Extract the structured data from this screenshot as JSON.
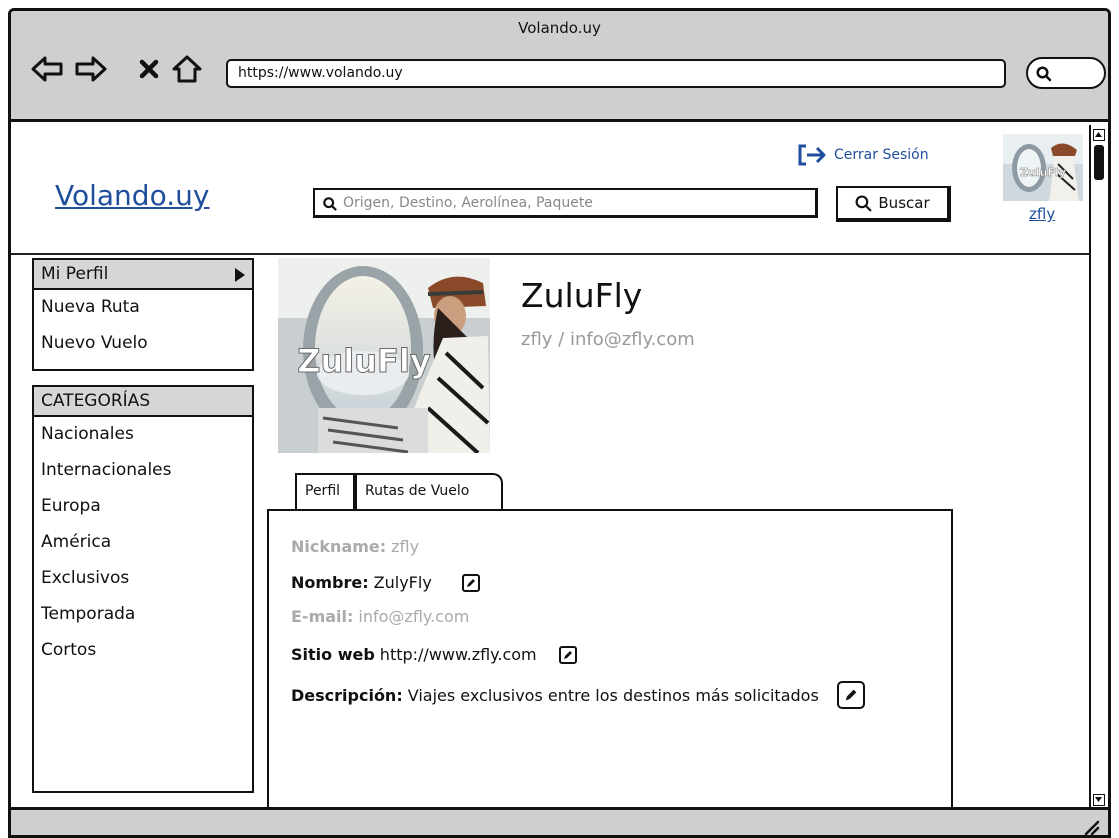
{
  "browser": {
    "title": "Volando.uy",
    "url": "https://www.volando.uy"
  },
  "header": {
    "logo": "Volando.uy",
    "search_placeholder": "Origen, Destino, Aerolínea, Paquete",
    "search_button": "Buscar",
    "logout": "Cerrar Sesión",
    "username": "zfly",
    "avatar_text": "ZuluFly"
  },
  "sidebar": {
    "user_menu": {
      "title": "Mi Perfil",
      "items": [
        "Nueva Ruta",
        "Nuevo Vuelo"
      ]
    },
    "categories": {
      "title": "CATEGORÍAS",
      "items": [
        "Nacionales",
        "Internacionales",
        "Europa",
        "América",
        "Exclusivos",
        "Temporada",
        "Cortos"
      ]
    }
  },
  "profile": {
    "photo_text": "ZuluFly",
    "name": "ZuluFly",
    "subtitle": "zfly / info@zfly.com",
    "tabs": [
      "Perfil",
      "Rutas de Vuelo"
    ],
    "fields": {
      "nickname_label": "Nickname:",
      "nickname_value": "zfly",
      "name_label": "Nombre:",
      "name_value": "ZulyFly",
      "email_label": "E-mail:",
      "email_value": "info@zfly.com",
      "web_label": "Sitio web",
      "web_value": "http://www.zfly.com",
      "desc_label": "Descripción:",
      "desc_value": "Viajes exclusivos entre los destinos más solicitados"
    }
  },
  "icons": {
    "back": "arrow-left-icon",
    "forward": "arrow-right-icon",
    "stop": "close-icon",
    "home": "home-icon",
    "search": "search-icon",
    "logout": "logout-icon",
    "edit": "pencil-icon",
    "chevron": "chevron-right-icon"
  },
  "colors": {
    "link": "#1f4f9c",
    "chrome": "#cfcfcf",
    "muted": "#999999"
  }
}
